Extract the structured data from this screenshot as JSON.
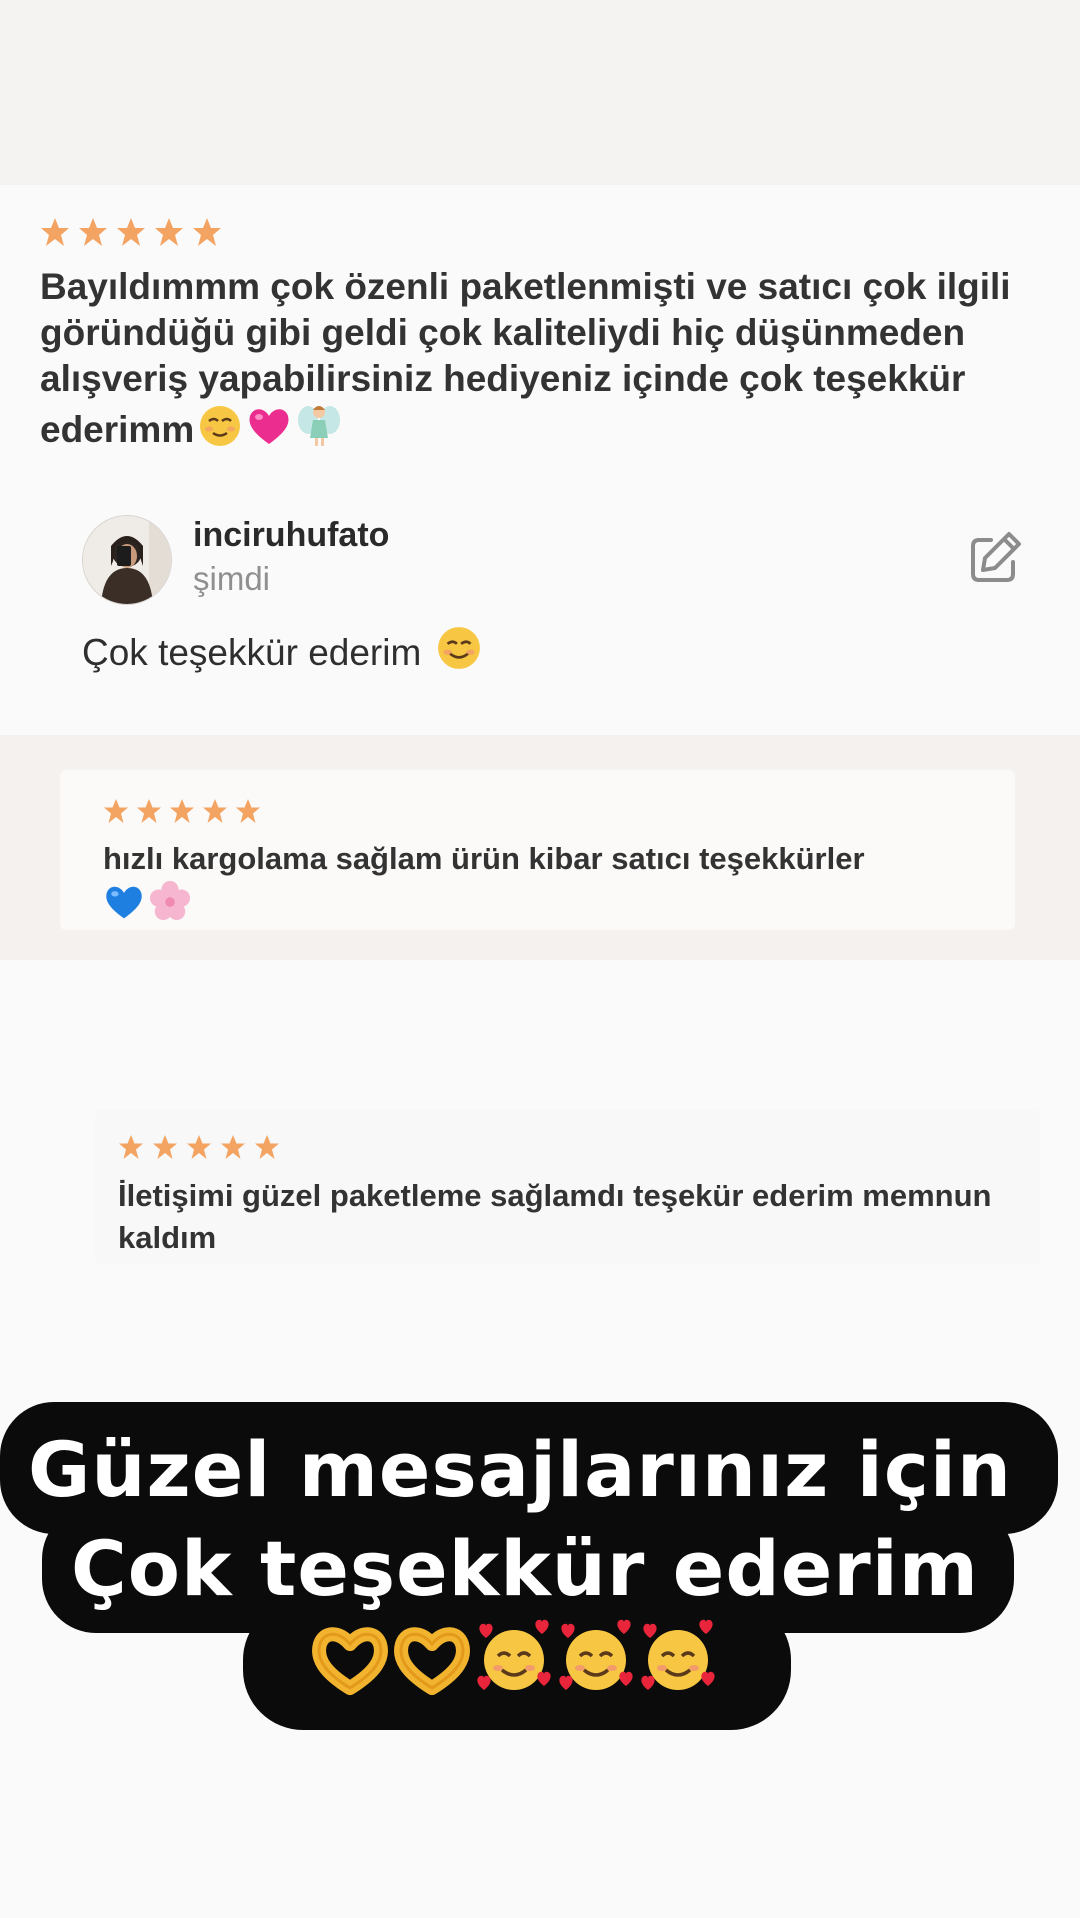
{
  "reviews": [
    {
      "rating": 5,
      "text": "Bayıldımmm çok özenli paketlenmişti ve satıcı çok ilgili göründüğü gibi geldi çok kaliteliydi hiç düşünmeden alışveriş yapabilirsiniz hediyeniz içinde çok teşekkür ederimm",
      "emojis": [
        "relieved-face",
        "pink-heart",
        "fairy"
      ]
    },
    {
      "rating": 5,
      "text": "hızlı kargolama sağlam ürün kibar satıcı teşekkürler",
      "emojis": [
        "blue-heart",
        "cherry-blossom"
      ]
    },
    {
      "rating": 5,
      "text": "İletişimi güzel paketleme sağlamdı teşekür ederim memnun kaldım",
      "emojis": []
    }
  ],
  "reply": {
    "username": "inciruhufato",
    "time": "şimdi",
    "text": "Çok teşekkür ederim",
    "emoji": "smiling-face"
  },
  "banner": {
    "line1": "Güzel mesajlarınız için",
    "line2": "Çok teşekkür ederim",
    "emojis": [
      "heart-hands",
      "heart-hands",
      "smiling-face-with-hearts",
      "smiling-face-with-hearts",
      "smiling-face-with-hearts"
    ]
  },
  "colors": {
    "star": "#f4a462",
    "banner_bg": "#0b0b0b",
    "text": "#2b2b2b",
    "muted": "#8f8f8f"
  }
}
